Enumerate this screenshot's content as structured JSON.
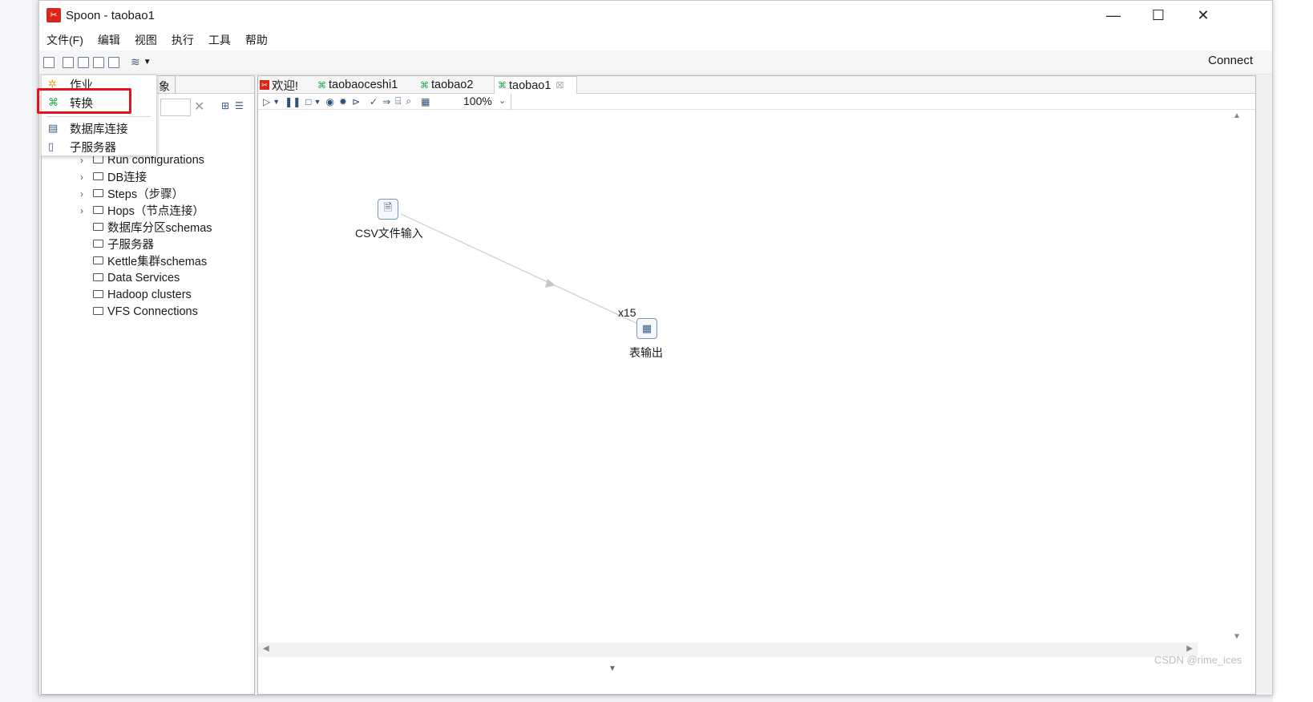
{
  "window": {
    "title": "Spoon - taobao1",
    "logo_icon": "spoon-logo-icon",
    "controls": [
      "—",
      "☐",
      "✕"
    ]
  },
  "menubar": [
    "文件(F)",
    "编辑",
    "视图",
    "执行",
    "工具",
    "帮助"
  ],
  "toolbar": {
    "connect_label": "Connect"
  },
  "left_panel": {
    "partial_tab_label": "象",
    "search_placeholder": "",
    "tree": [
      {
        "label": "Run configurations",
        "expandable": true
      },
      {
        "label": "DB连接",
        "expandable": true
      },
      {
        "label": "Steps（步骤）",
        "expandable": true
      },
      {
        "label": "Hops（节点连接）",
        "expandable": true
      },
      {
        "label": "数据库分区schemas",
        "expandable": false
      },
      {
        "label": "子服务器",
        "expandable": false
      },
      {
        "label": "Kettle集群schemas",
        "expandable": false
      },
      {
        "label": "Data Services",
        "expandable": false
      },
      {
        "label": "Hadoop clusters",
        "expandable": false
      },
      {
        "label": "VFS Connections",
        "expandable": false
      }
    ]
  },
  "dropdown": {
    "items": [
      {
        "label": "作业",
        "icon": "job-icon"
      },
      {
        "label": "转换",
        "icon": "transformation-icon",
        "highlighted": true
      },
      {
        "label": "数据库连接",
        "icon": "database-icon"
      },
      {
        "label": "子服务器",
        "icon": "server-icon"
      }
    ]
  },
  "tabs": [
    {
      "label": "欢迎!",
      "icon": "spoon-logo-icon",
      "active": false
    },
    {
      "label": "taobaoceshi1",
      "icon": "transformation-icon",
      "active": false
    },
    {
      "label": "taobao2",
      "icon": "transformation-icon",
      "active": false
    },
    {
      "label": "taobao1",
      "icon": "transformation-icon",
      "active": true,
      "closable": true
    }
  ],
  "canvas_toolbar": {
    "zoom": "100%"
  },
  "canvas": {
    "steps": [
      {
        "label": "CSV文件输入",
        "icon": "csv-input-icon"
      },
      {
        "label": "表输出",
        "icon": "table-output-icon"
      }
    ],
    "hop_label": "x15"
  },
  "watermark": "CSDN @rime_ices",
  "colors": {
    "highlight": "#e3141f",
    "spoon_red": "#d9261c",
    "transform_green": "#1aa84a"
  }
}
